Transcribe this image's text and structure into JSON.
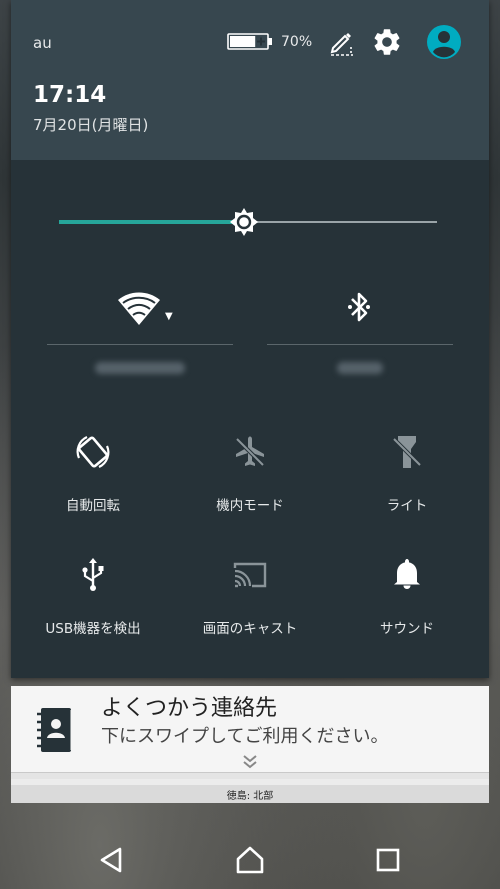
{
  "status": {
    "carrier": "au",
    "battery_percent": "70%",
    "battery_level": 0.7
  },
  "header": {
    "time": "17:14",
    "date": "7月20日(月曜日)"
  },
  "brightness": {
    "level": 0.49
  },
  "tiles": {
    "wifi": {
      "network_name": ""
    },
    "bluetooth": {
      "device_name": ""
    },
    "auto_rotate": "自動回転",
    "airplane_mode": "機内モード",
    "flashlight": "ライト",
    "usb": "USB機器を検出",
    "cast": "画面のキャスト",
    "sound": "サウンド"
  },
  "notification": {
    "title": "よくつかう連絡先",
    "subtitle": "下にスワイプしてご利用ください。",
    "peek_text": "徳島: 北部"
  },
  "colors": {
    "accent": "#26a69a",
    "user_avatar": "#00acc1",
    "shade_bg": "#263238",
    "header_bg": "#37474f"
  }
}
